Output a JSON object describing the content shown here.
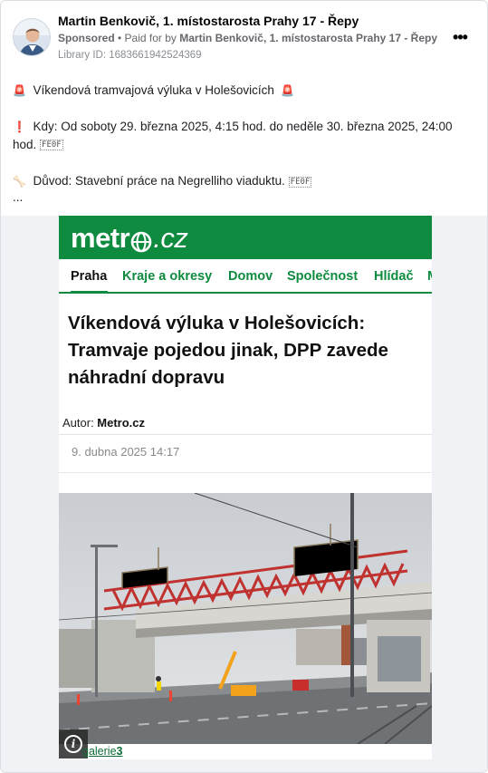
{
  "advertiser": {
    "name": "Martin Benkovič, 1. místostarosta Prahy 17 - Řepy",
    "sponsored": "Sponsored",
    "paid_for_prefix": " • Paid for by ",
    "paid_for_name": "Martin Benkovič, 1. místostarosta Prahy 17 - Řepy",
    "library_id": "Library ID: 1683661942524369",
    "more_icon": "more-options-icon"
  },
  "post": {
    "line1": "Víkendová tramvajová výluka v Holešovicích",
    "line2a": "Kdy: Od soboty 29. března 2025, 4:15 hod. do neděle 30. března 2025, 24:00",
    "line2b": "hod.",
    "line3": "Důvod: Stavební práce na Negrelliho viaduktu.",
    "ellipsis": "...",
    "emoji_siren": "🚨",
    "emoji_excl": "❗",
    "emoji_bone": "🦴",
    "box_glyph": "FE0F"
  },
  "article": {
    "logo_left": "metr",
    "logo_right": ".cz",
    "nav": [
      "Praha",
      "Kraje a okresy",
      "Domov",
      "Společnost",
      "Hlídač",
      "M"
    ],
    "headline": "Víkendová výluka v Holešovicích: Tramvaje pojedou jinak, DPP zavede náhradní dopravu",
    "author_label": "Autor: ",
    "author_name": "Metro.cz",
    "date": "9. dubna 2025  14:17",
    "gallery_prefix": "galerie",
    "gallery_count": "3",
    "info_icon": "info-icon"
  },
  "colors": {
    "metro_green": "#0e8b3f",
    "text": "#1c1e21",
    "muted": "#65676b"
  }
}
